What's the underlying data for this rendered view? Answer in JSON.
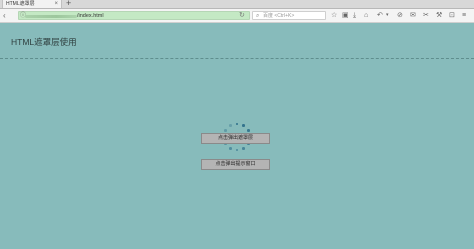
{
  "browser": {
    "tab_title": "HTML遮罩层",
    "tab_close": "×",
    "new_tab": "+",
    "url": "/index.html",
    "search_placeholder": "百度 <Ctrl+K>",
    "icons": [
      "back-icon",
      "info-icon",
      "reload-icon",
      "search-icon",
      "bookmark-star-icon",
      "reading-list-icon",
      "download-icon",
      "home-icon",
      "undo-icon",
      "chevron-down-icon",
      "block-icon",
      "chat-icon",
      "screenshot-icon",
      "tools-icon",
      "extension-icon",
      "menu-icon"
    ]
  },
  "page": {
    "title": "HTML遮罩层使用",
    "button_1": "点击弹出遮罩层",
    "button_2": "点击弹出提示窗口"
  }
}
